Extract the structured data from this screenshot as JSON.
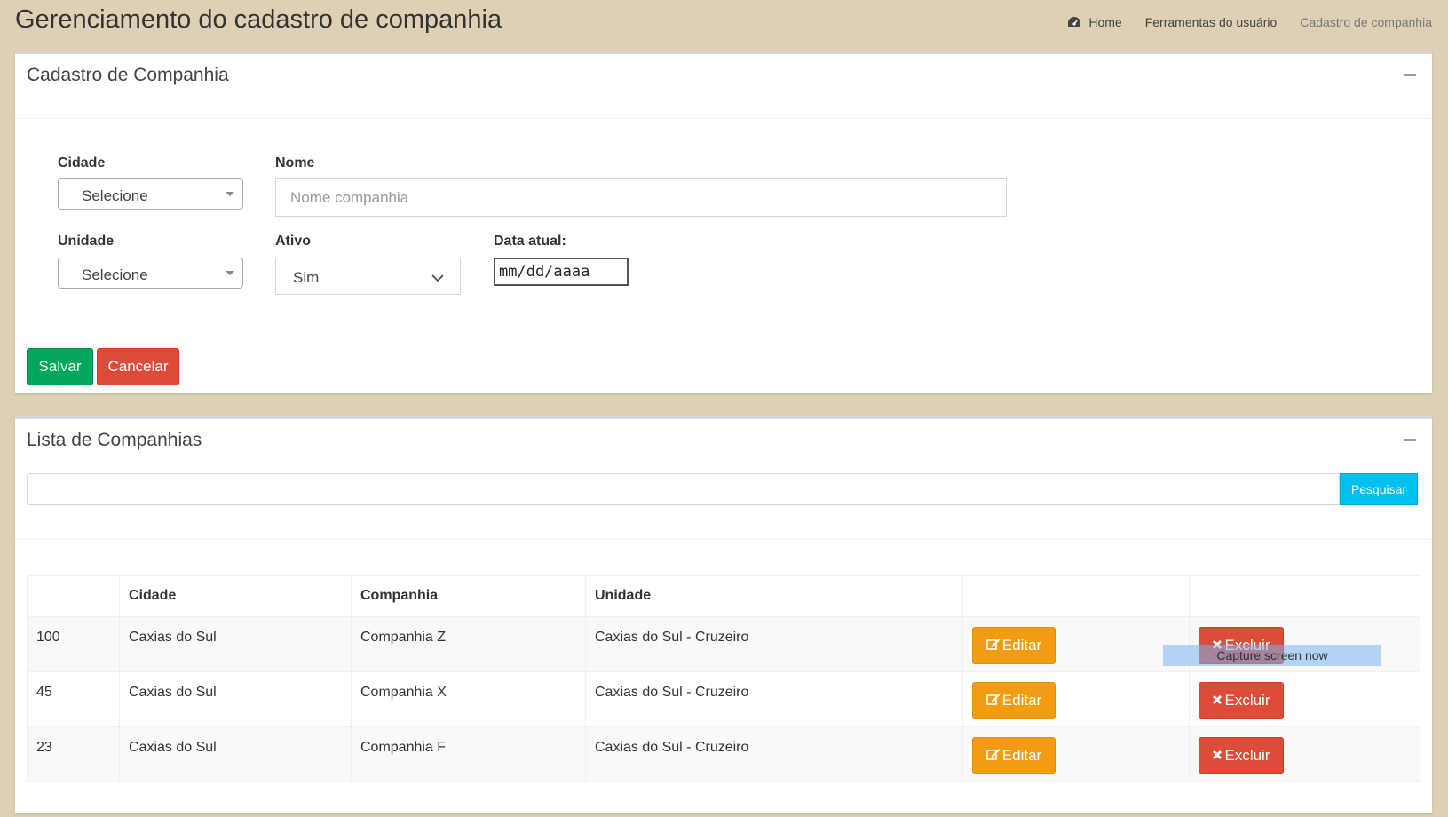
{
  "header": {
    "title": "Gerenciamento do cadastro de companhia",
    "breadcrumb": [
      "Home",
      "Ferramentas do usuário",
      "Cadastro de companhia"
    ]
  },
  "form_box": {
    "title": "Cadastro de Companhia",
    "fields": {
      "cidade": {
        "label": "Cidade",
        "value": "Selecione"
      },
      "nome": {
        "label": "Nome",
        "placeholder": "Nome companhia",
        "value": ""
      },
      "unidade": {
        "label": "Unidade",
        "value": "Selecione"
      },
      "ativo": {
        "label": "Ativo",
        "value": "Sim"
      },
      "data": {
        "label": "Data atual:",
        "value": "mm/dd/aaaa"
      }
    },
    "buttons": {
      "save": "Salvar",
      "cancel": "Cancelar"
    }
  },
  "list_box": {
    "title": "Lista de Companhias",
    "search_button": "Pesquisar",
    "search_value": "",
    "columns": [
      "",
      "Cidade",
      "Companhia",
      "Unidade",
      "",
      ""
    ],
    "rows": [
      {
        "id": "100",
        "cidade": "Caxias do Sul",
        "companhia": "Companhia Z",
        "unidade": "Caxias do Sul - Cruzeiro"
      },
      {
        "id": "45",
        "cidade": "Caxias do Sul",
        "companhia": "Companhia X",
        "unidade": "Caxias do Sul - Cruzeiro"
      },
      {
        "id": "23",
        "cidade": "Caxias do Sul",
        "companhia": "Companhia F",
        "unidade": "Caxias do Sul - Cruzeiro"
      }
    ],
    "edit_label": "Editar",
    "delete_label": "Excluir"
  },
  "overlay": {
    "text": "Capture screen now"
  },
  "colors": {
    "background": "#ddd0b4",
    "save": "#00a65a",
    "cancel": "#dd4b39",
    "edit": "#f39c12",
    "delete": "#dd4b39",
    "search": "#00c0ef"
  },
  "icons": [
    "dashboard-icon",
    "collapse-icon",
    "chevron-down-icon",
    "edit-icon",
    "times-icon"
  ]
}
